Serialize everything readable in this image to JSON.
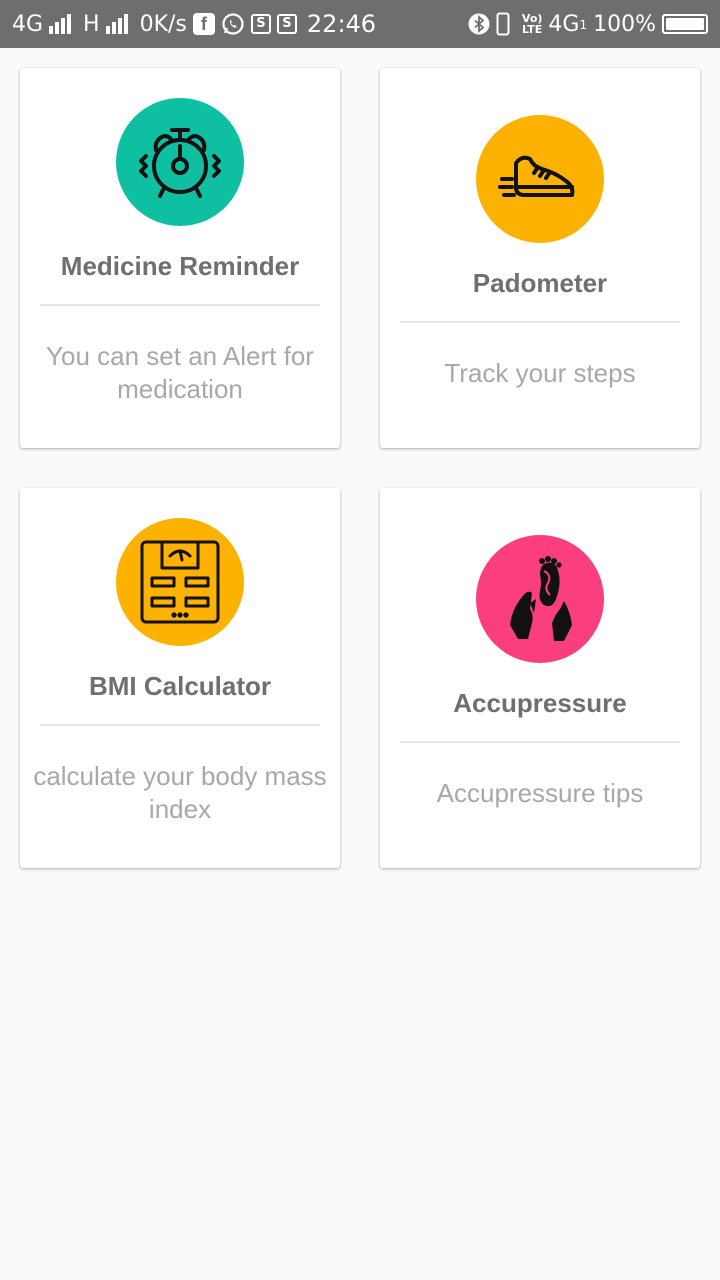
{
  "status_bar": {
    "network_1": "4G",
    "network_2": "H",
    "speed": "0K/s",
    "time": "22:46",
    "volte_top": "Vo)",
    "volte_bottom": "LTE",
    "network_3": "4G",
    "network_3_sub": "1",
    "battery": "100%",
    "battery_level": 1.0
  },
  "cards": [
    {
      "title": "Medicine Reminder",
      "description": "You can set an Alert for medication",
      "icon": "alarm-clock-icon",
      "color": "#0fbfa1"
    },
    {
      "title": "Padometer",
      "description": "Track your steps",
      "icon": "shoe-icon",
      "color": "#fdb100"
    },
    {
      "title": "BMI Calculator",
      "description": "calculate your body mass index",
      "icon": "weighing-scale-icon",
      "color": "#fdb100"
    },
    {
      "title": "Accupressure",
      "description": "Accupressure tips",
      "icon": "hands-foot-icon",
      "color": "#fb3f7e"
    }
  ]
}
